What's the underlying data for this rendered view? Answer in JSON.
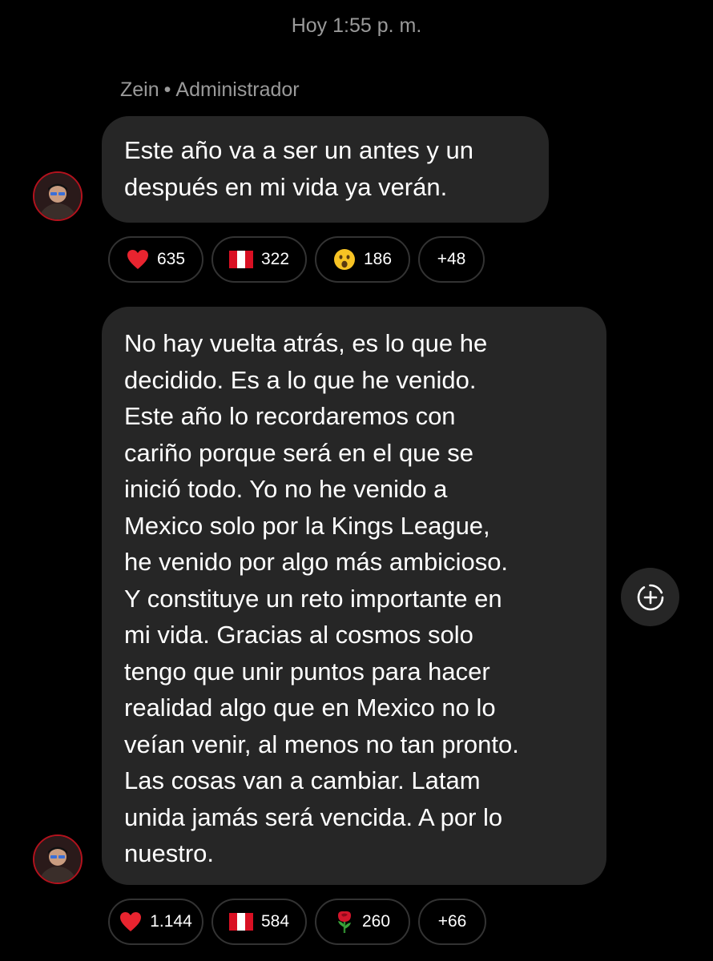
{
  "timestamp": "Hoy 1:55 p. m.",
  "sender": {
    "name": "Zein",
    "separator": "•",
    "role": "Administrador"
  },
  "messages": [
    {
      "lines": [
        "Este año va a ser un antes y un",
        "después en mi vida ya verán."
      ],
      "avatar_icon": "user-avatar",
      "reactions": [
        {
          "icon": "red-heart-icon",
          "count": "635"
        },
        {
          "icon": "peru-flag-icon",
          "count": "322"
        },
        {
          "icon": "surprised-face-icon",
          "count": "186"
        }
      ],
      "more_reactions": "+48"
    },
    {
      "lines": [
        "No hay vuelta atrás, es lo que he",
        "decidido. Es a lo que he venido.",
        "Este año lo recordaremos con",
        "cariño porque será en el que se",
        "inició todo. Yo no he venido a",
        "Mexico solo por la Kings League,",
        "he venido por algo más ambicioso.",
        "Y constituye un reto importante en",
        "mi vida. Gracias al cosmos solo",
        "tengo que unir puntos para hacer",
        "realidad algo que en Mexico no lo",
        "veían venir, al menos no tan pronto.",
        "Las cosas van a cambiar. Latam",
        "unida jamás será vencida. A por lo",
        "nuestro."
      ],
      "avatar_icon": "user-avatar",
      "reactions": [
        {
          "icon": "red-heart-icon",
          "count": "1.144"
        },
        {
          "icon": "peru-flag-icon",
          "count": "584"
        },
        {
          "icon": "rose-icon",
          "count": "260"
        }
      ],
      "more_reactions": "+66"
    }
  ],
  "add_reaction_icon": "add-reaction-icon",
  "colors": {
    "background": "#000000",
    "bubble": "#262626",
    "muted_text": "#9a9a9a",
    "pill_border": "#333333",
    "avatar_ring": "#b3121d"
  }
}
